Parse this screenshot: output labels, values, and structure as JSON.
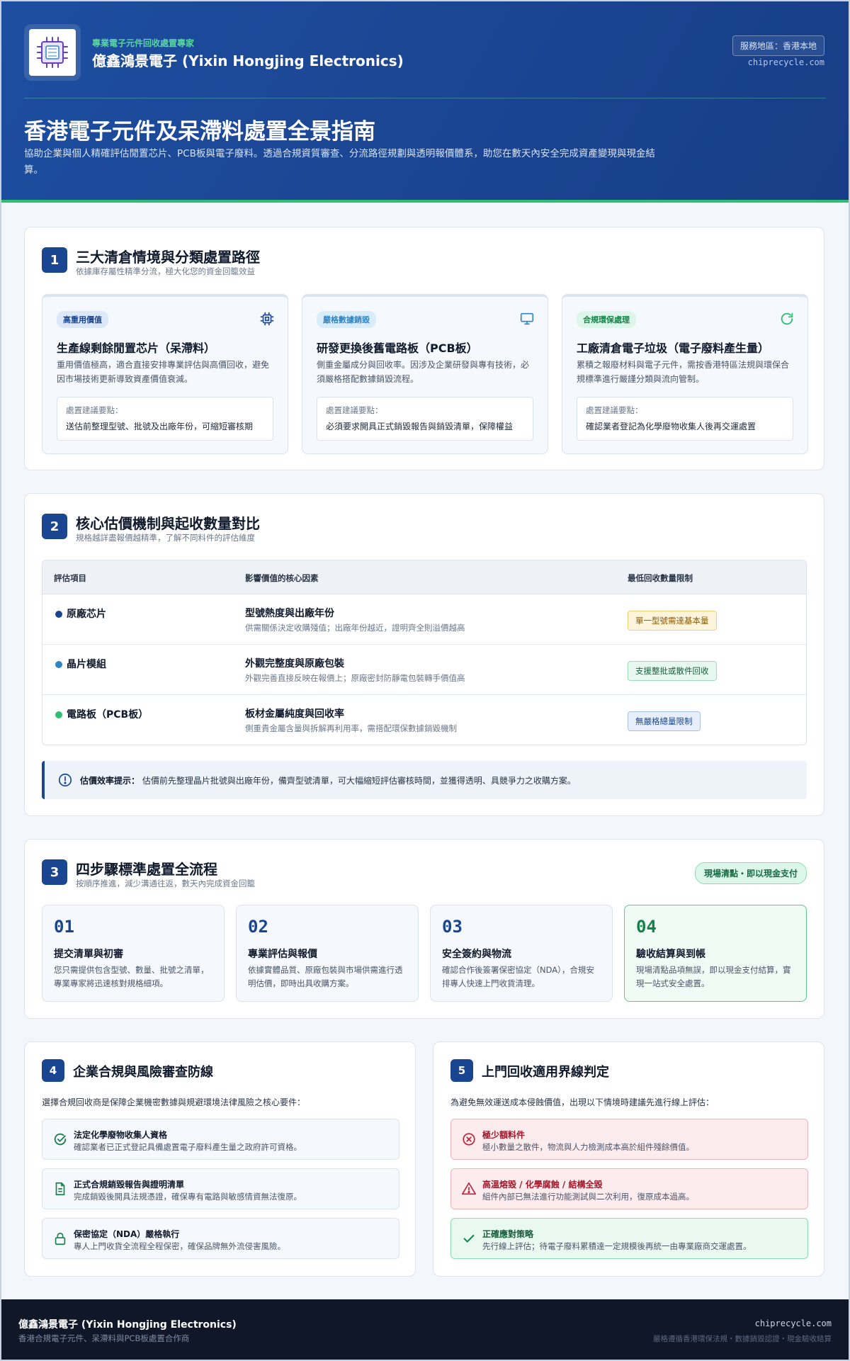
{
  "header": {
    "brand_tag": "專業電子元件回收處置專家",
    "brand_name": "億鑫鴻景電子 (Yixin Hongjing Electronics)",
    "service_area": "服務地區：香港本地",
    "domain": "chiprecycle.com",
    "title": "香港電子元件及呆滯料處置全景指南",
    "description": "協助企業與個人精確評估閒置芯片、PCB板與電子廢料。透過合規資質審查、分流路徑規劃與透明報價體系，助您在數天內安全完成資產變現與現金結算。"
  },
  "section1": {
    "number": "1",
    "title": "三大清倉情境與分類處置路徑",
    "subtitle": "依據庫存屬性精準分流，極大化您的資金回籠效益",
    "cards": [
      {
        "tag": "高重用價值",
        "icon": "chip-icon",
        "title": "生產線剩餘閒置芯片（呆滯料）",
        "desc": "重用價值極高，適合直接安排專業評估與高價回收，避免因市場技術更新導致資產價值衰減。",
        "box_label": "處置建議要點：",
        "box_text": "送估前整理型號、批號及出廠年份，可縮短審核期",
        "accent": "#1a4590"
      },
      {
        "tag": "嚴格數據銷毀",
        "icon": "monitor-icon",
        "title": "研發更換後舊電路板（PCB板）",
        "desc": "側重金屬成分與回收率。因涉及企業研發與專有技術，必須嚴格搭配數據銷毀流程。",
        "box_label": "處置建議要點：",
        "box_text": "必須要求開具正式銷毀報告與銷毀清單，保障權益",
        "accent": "#2f86c7"
      },
      {
        "tag": "合規環保處理",
        "icon": "refresh-icon",
        "title": "工廠清倉電子垃圾（電子廢料產生量）",
        "desc": "累積之報廢材料與電子元件，需按香港特區法規與環保合規標準進行嚴謹分類與流向管制。",
        "box_label": "處置建議要點：",
        "box_text": "確認業者登記為化學廢物收集人後再交運處置",
        "accent": "#2fbf71"
      }
    ]
  },
  "section2": {
    "number": "2",
    "title": "核心估價機制與起收數量對比",
    "subtitle": "規格越詳盡報價越精準，了解不同料件的評估維度",
    "headers": [
      "評估項目",
      "影響價值的核心因素",
      "最低回收數量限制"
    ],
    "rows": [
      {
        "item": "原廠芯片",
        "dot": "#1a4590",
        "factor": "型號熱度與出廠年份",
        "factor_desc": "供需關係決定收購殘值；出廠年份越近，證明齊全則溢價越高",
        "limit": "單一型號需達基本量",
        "limit_style": "amber"
      },
      {
        "item": "晶片模組",
        "dot": "#2f86c7",
        "factor": "外觀完整度與原廠包裝",
        "factor_desc": "外觀完善直接反映在報價上；原廠密封防靜電包裝轉手價值高",
        "limit": "支援整批或散件回收",
        "limit_style": "green"
      },
      {
        "item": "電路板（PCB板）",
        "dot": "#2fbf71",
        "factor": "板材金屬純度與回收率",
        "factor_desc": "側重貴金屬含量與拆解再利用率，需搭配環保數據銷毀機制",
        "limit": "無嚴格總量限制",
        "limit_style": "blue"
      }
    ],
    "tip_label": "估價效率提示：",
    "tip_text": "估價前先整理晶片批號與出廠年份，備齊型號清單，可大幅縮短評估審核時間，並獲得透明、具競爭力之收購方案。"
  },
  "section3": {
    "number": "3",
    "title": "四步驟標準處置全流程",
    "subtitle": "按順序推進，減少溝通往返，數天內完成資金回籠",
    "badge": "現場清點・即以現金支付",
    "steps": [
      {
        "num": "01",
        "title": "提交清單與初審",
        "desc": "您只需提供包含型號、數量、批號之清單，專業專家將迅速核對規格細項。"
      },
      {
        "num": "02",
        "title": "專業評估與報價",
        "desc": "依據實體品質、原廠包裝與市場供需進行透明估價，即時出具收購方案。"
      },
      {
        "num": "03",
        "title": "安全簽約與物流",
        "desc": "確認合作後簽署保密協定（NDA），合規安排專人快速上門收貨清理。"
      },
      {
        "num": "04",
        "title": "驗收結算與到帳",
        "desc": "現場清點品項無誤，即以現金支付結算，實現一站式安全處置。"
      }
    ]
  },
  "section4": {
    "number": "4",
    "title": "企業合規與風險審查防線",
    "intro": "選擇合規回收商是保障企業機密數據與規避環境法律風險之核心要件：",
    "items": [
      {
        "icon": "check-circle-icon",
        "title": "法定化學廢物收集人資格",
        "desc": "確認業者已正式登記具備處置電子廢料產生量之政府許可資格。"
      },
      {
        "icon": "document-icon",
        "title": "正式合規銷毀報告與證明清單",
        "desc": "完成銷毀後開具法規憑證，確保專有電路與敏感情資無法復原。"
      },
      {
        "icon": "lock-icon",
        "title": "保密協定（NDA）嚴格執行",
        "desc": "專人上門收貨全流程全程保密，確保品牌無外流侵害風險。"
      }
    ]
  },
  "section5": {
    "number": "5",
    "title": "上門回收適用界線判定",
    "intro": "為避免無效運送成本侵蝕價值，出現以下情境時建議先進行線上評估：",
    "items": [
      {
        "icon": "x-circle-icon",
        "title": "極少額料件",
        "desc": "極小數量之散件，物流與人力檢測成本高於組件殘餘價值。",
        "style": "warn"
      },
      {
        "icon": "warning-icon",
        "title": "高溫熔毀 / 化學腐蝕 / 結構全毀",
        "desc": "組件內部已無法進行功能測試與二次利用，復原成本過高。",
        "style": "warn"
      },
      {
        "icon": "check-icon",
        "title": "正確應對策略",
        "desc": "先行線上評估；待電子廢料累積達一定規模後再統一由專業廠商交運處置。",
        "style": "ok"
      }
    ]
  },
  "footer": {
    "name": "億鑫鴻景電子 (Yixin Hongjing Electronics)",
    "sub": "香港合規電子元件、呆滯料與PCB板處置合作商",
    "domain": "chiprecycle.com",
    "note": "嚴格遵循香港環保法規・數據銷毀認證・現金驗收結算"
  }
}
